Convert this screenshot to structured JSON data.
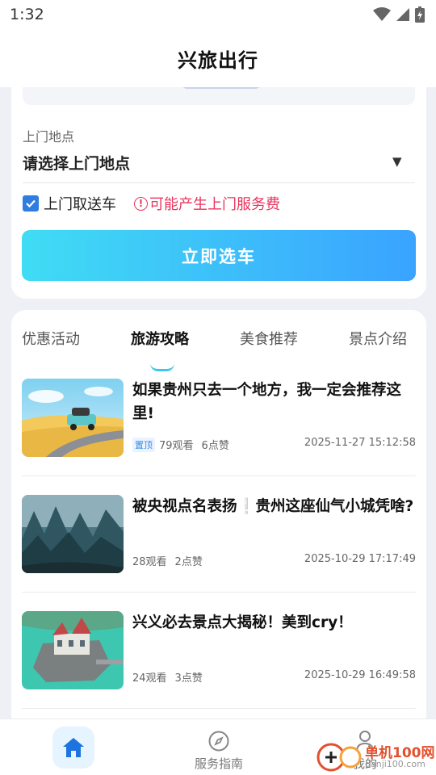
{
  "status_bar": {
    "time": "1:32"
  },
  "header": {
    "title": "兴旅出行"
  },
  "booking": {
    "location_label": "上门地点",
    "location_value": "请选择上门地点",
    "pickup_label": "上门取送车",
    "pickup_checked": true,
    "fee_note": "可能产生上门服务费",
    "select_button": "立即选车"
  },
  "tabs": [
    {
      "label": "优惠活动",
      "active": false
    },
    {
      "label": "旅游攻略",
      "active": true
    },
    {
      "label": "美食推荐",
      "active": false
    },
    {
      "label": "景点介绍",
      "active": false
    }
  ],
  "articles": [
    {
      "title": "如果贵州只去一个地方，我一定会推荐这里!",
      "pinned": true,
      "pin_label": "置顶",
      "views": "79观看",
      "likes": "6点赞",
      "date": "2025-11-27 15:12:58"
    },
    {
      "title": "被央视点名表扬❕贵州这座仙气小城凭啥?",
      "pinned": false,
      "views": "28观看",
      "likes": "2点赞",
      "date": "2025-10-29 17:17:49"
    },
    {
      "title": "兴义必去景点大揭秘！美到cry！",
      "pinned": false,
      "views": "24观看",
      "likes": "3点赞",
      "date": "2025-10-29 16:49:58"
    }
  ],
  "bottom_nav": {
    "home_icon": "home-icon",
    "guide_label": "服务指南",
    "profile_label": "我的"
  },
  "watermark": {
    "text": "单机100网",
    "url": "danji100.com"
  },
  "colors": {
    "accent": "#3aa3ff",
    "accent_light": "#40dcf4",
    "warning": "#e8355c",
    "checkbox": "#2f7de1"
  }
}
